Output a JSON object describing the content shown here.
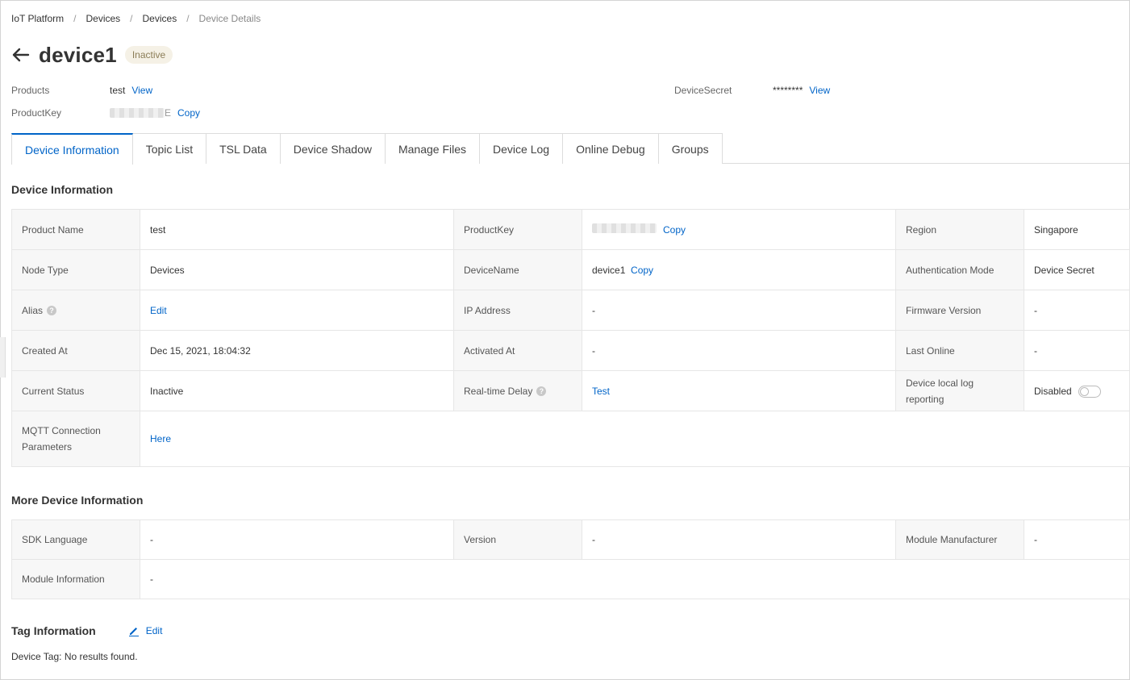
{
  "breadcrumb": [
    "IoT Platform",
    "Devices",
    "Devices",
    "Device Details"
  ],
  "header": {
    "title": "device1",
    "status": "Inactive"
  },
  "meta": {
    "products_label": "Products",
    "products_value": "test",
    "products_link": "View",
    "productkey_label": "ProductKey",
    "productkey_tail": "E",
    "productkey_link": "Copy",
    "secret_label": "DeviceSecret",
    "secret_value": "********",
    "secret_link": "View"
  },
  "tabs": [
    "Device Information",
    "Topic List",
    "TSL Data",
    "Device Shadow",
    "Manage Files",
    "Device Log",
    "Online Debug",
    "Groups"
  ],
  "device_info": {
    "title": "Device Information",
    "rows": [
      [
        {
          "label": "Product Name",
          "value": "test"
        },
        {
          "label": "ProductKey",
          "value": "",
          "link": "Copy"
        },
        {
          "label": "Region",
          "value": "Singapore"
        }
      ],
      [
        {
          "label": "Node Type",
          "value": "Devices"
        },
        {
          "label": "DeviceName",
          "value": "device1",
          "link": "Copy"
        },
        {
          "label": "Authentication Mode",
          "value": "Device Secret"
        }
      ],
      [
        {
          "label": "Alias",
          "link": "Edit"
        },
        {
          "label": "IP Address",
          "value": "-"
        },
        {
          "label": "Firmware Version",
          "value": "-"
        }
      ],
      [
        {
          "label": "Created At",
          "value": "Dec 15, 2021, 18:04:32"
        },
        {
          "label": "Activated At",
          "value": "-"
        },
        {
          "label": "Last Online",
          "value": "-"
        }
      ],
      [
        {
          "label": "Current Status",
          "value": "Inactive"
        },
        {
          "label": "Real-time Delay",
          "link": "Test"
        },
        {
          "label": "Device local log reporting",
          "value": "Disabled"
        }
      ],
      [
        {
          "label": "MQTT Connection Parameters",
          "link": "Here"
        }
      ]
    ]
  },
  "more_info": {
    "title": "More Device Information",
    "rows": [
      [
        {
          "label": "SDK Language",
          "value": "-"
        },
        {
          "label": "Version",
          "value": "-"
        },
        {
          "label": "Module Manufacturer",
          "value": "-"
        }
      ],
      [
        {
          "label": "Module Information",
          "value": "-"
        }
      ]
    ]
  },
  "tags": {
    "title": "Tag Information",
    "edit": "Edit",
    "empty": "Device Tag: No results found."
  },
  "colors": {
    "accent": "#0064c8",
    "badge_bg": "#f5f1e6",
    "label_bg": "#f7f7f7"
  },
  "icons": {
    "back": "arrow-left-icon",
    "help": "question-circle-icon",
    "edit": "pencil-icon"
  }
}
